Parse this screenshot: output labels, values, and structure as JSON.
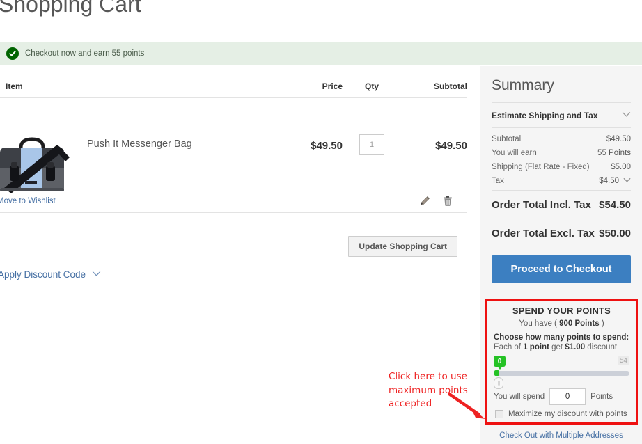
{
  "page": {
    "title": "Shopping Cart"
  },
  "reward_banner": {
    "icon": "check-circle-icon",
    "text": "Checkout now and earn 55 points"
  },
  "cart": {
    "columns": {
      "item": "Item",
      "price": "Price",
      "qty": "Qty",
      "subtotal": "Subtotal"
    },
    "rows": [
      {
        "name": "Push It Messenger Bag",
        "price": "$49.50",
        "qty": "1",
        "subtotal": "$49.50",
        "wishlist_link": "Move to Wishlist",
        "edit_icon": "pencil-icon",
        "delete_icon": "trash-icon"
      }
    ],
    "update_button": "Update Shopping Cart",
    "discount_link": "Apply Discount Code",
    "discount_chevron": "chevron-down-icon"
  },
  "summary": {
    "title": "Summary",
    "estimate": {
      "label": "Estimate Shipping and Tax",
      "chevron": "chevron-down-icon"
    },
    "lines": [
      {
        "label": "Subtotal",
        "value": "$49.50",
        "chevron": false
      },
      {
        "label": "You will earn",
        "value": "55 Points",
        "chevron": false
      },
      {
        "label": "Shipping (Flat Rate - Fixed)",
        "value": "$5.00",
        "chevron": false
      },
      {
        "label": "Tax",
        "value": "$4.50",
        "chevron": true
      }
    ],
    "totals": [
      {
        "label": "Order Total Incl. Tax",
        "value": "$54.50"
      },
      {
        "label": "Order Total Excl. Tax",
        "value": "$50.00"
      }
    ],
    "checkout_button": "Proceed to Checkout",
    "multi_address_link": "Check Out with Multiple Addresses"
  },
  "points_box": {
    "title": "SPEND YOUR POINTS",
    "have_prefix": "You have (",
    "have_value": "900 Points",
    "have_suffix": ")",
    "choose_label": "Choose how many points to spend:",
    "each_prefix": "Each of",
    "each_point": "1 point",
    "each_middle": "get",
    "each_amount": "$1.00",
    "each_suffix": "discount",
    "slider": {
      "current": "0",
      "max": "54"
    },
    "spend_label": "You will spend",
    "spend_value": "0",
    "spend_unit": "Points",
    "maximize_label": "Maximize my discount with points",
    "maximize_checked": false
  },
  "annotation": {
    "text": "Click here to use maximum points accepted",
    "color": "#ee2222"
  },
  "colors": {
    "accent_blue": "#3c7fc1",
    "link_blue": "#456fa3",
    "banner_green_bg": "#e5efe5",
    "check_green": "#006400",
    "slider_green": "#25c225",
    "annotation_red": "#ee1111",
    "sidebar_bg": "#f5f5f5"
  }
}
